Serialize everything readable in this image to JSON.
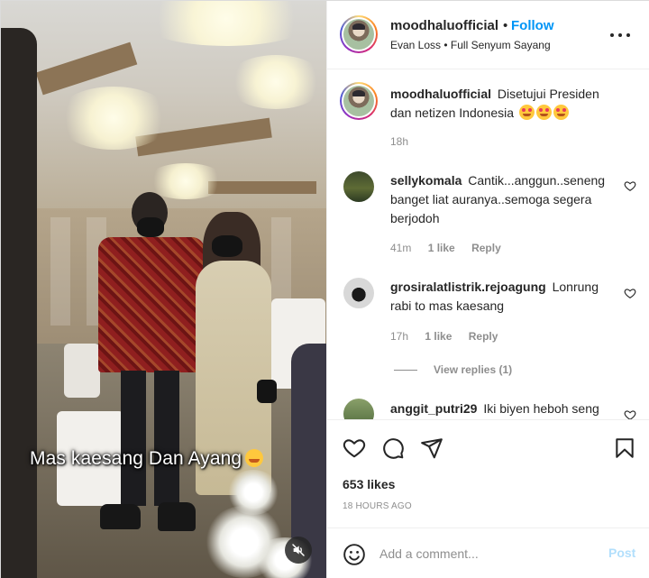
{
  "media": {
    "caption_overlay": "Mas kaesang Dan Ayang",
    "caption_emoji": "smiling-face-with-hearts-emoji",
    "mute_icon": "speaker-muted-icon"
  },
  "post": {
    "username": "moodhaluofficial",
    "separator": "•",
    "follow_label": "Follow",
    "audio_info": "Evan Loss • Full Senyum Sayang",
    "more_icon": "more-options-icon"
  },
  "caption": {
    "username": "moodhaluofficial",
    "text": "Disetujui Presiden dan netizen Indonesia",
    "emoji_count": 3,
    "emoji": "smiling-face-with-hearts-emoji",
    "time": "18h"
  },
  "comments": [
    {
      "username": "sellykomala",
      "text": "Cantik...anggun..seneng banget liat auranya..semoga segera berjodoh",
      "time": "41m",
      "likes": "1 like",
      "reply_label": "Reply"
    },
    {
      "username": "grosiralatlistrik.rejoagung",
      "text": "Lonrung rabi to mas kaesang",
      "time": "17h",
      "likes": "1 like",
      "reply_label": "Reply",
      "view_replies": "View replies (1)"
    },
    {
      "username": "anggit_putri29",
      "text": "Iki biyen heboh seng"
    }
  ],
  "actions": {
    "like_icon": "heart-icon",
    "comment_icon": "comment-icon",
    "share_icon": "paper-plane-icon",
    "save_icon": "bookmark-icon",
    "likes_count": "653 likes",
    "time_ago": "18 HOURS AGO"
  },
  "add_comment": {
    "emoji_icon": "emoji-smile-icon",
    "placeholder": "Add a comment...",
    "post_label": "Post"
  },
  "colors": {
    "link_blue": "#0095f6",
    "post_disabled": "#b2dffc",
    "muted_text": "#8e8e8e",
    "primary_text": "#262626",
    "divider": "#efefef"
  }
}
